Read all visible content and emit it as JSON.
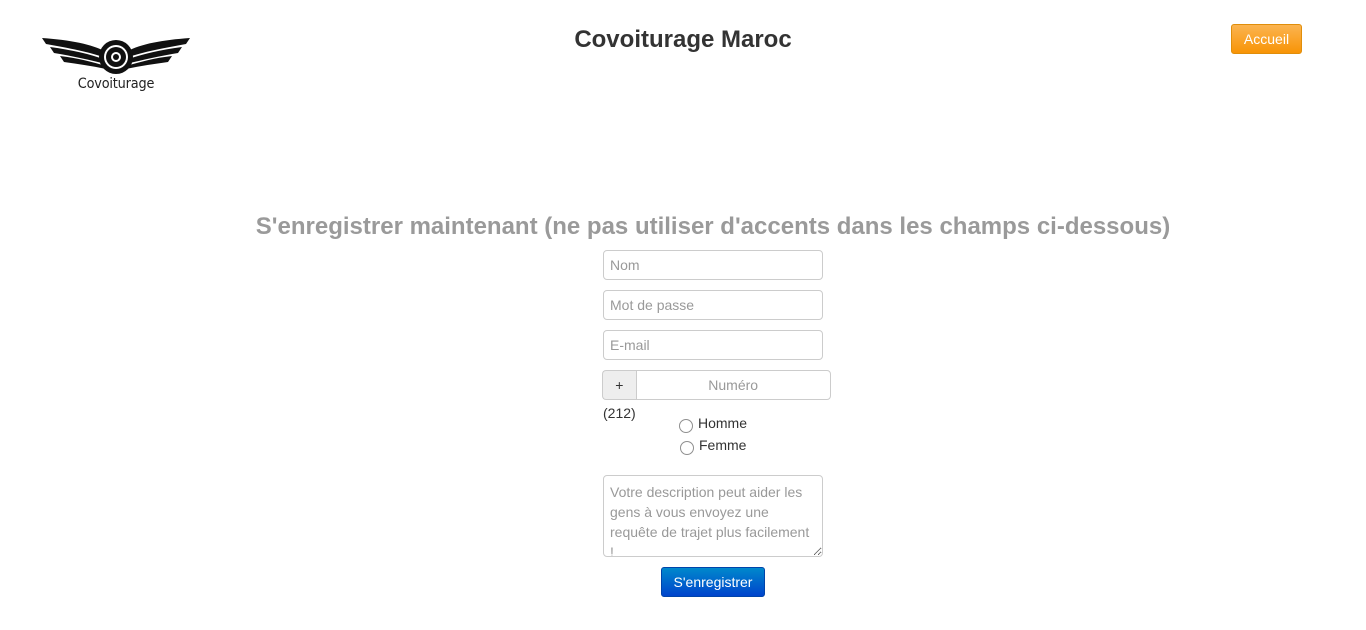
{
  "brand": {
    "logo_text": "Covoiturage",
    "site_title": "Covoiturage Maroc"
  },
  "header": {
    "home_button_label": "Accueil"
  },
  "register": {
    "heading": "S'enregistrer maintenant (ne pas utiliser d'accents dans les champs ci-dessous)",
    "name_placeholder": "Nom",
    "password_placeholder": "Mot de passe",
    "email_placeholder": "E-mail",
    "phone_prefix": "+(212)",
    "phone_placeholder": "Numéro",
    "gender_options": [
      "Homme",
      "Femme"
    ],
    "description_placeholder": "Votre description peut aider les gens à vous envoyez une requête de trajet plus facilement !",
    "submit_label": "S'enregistrer"
  },
  "colors": {
    "accent_orange": "#f89406",
    "primary_blue": "#0066cc",
    "heading_gray": "#9a9a9a"
  },
  "icons": {
    "logo": "winged-wheel-icon"
  }
}
